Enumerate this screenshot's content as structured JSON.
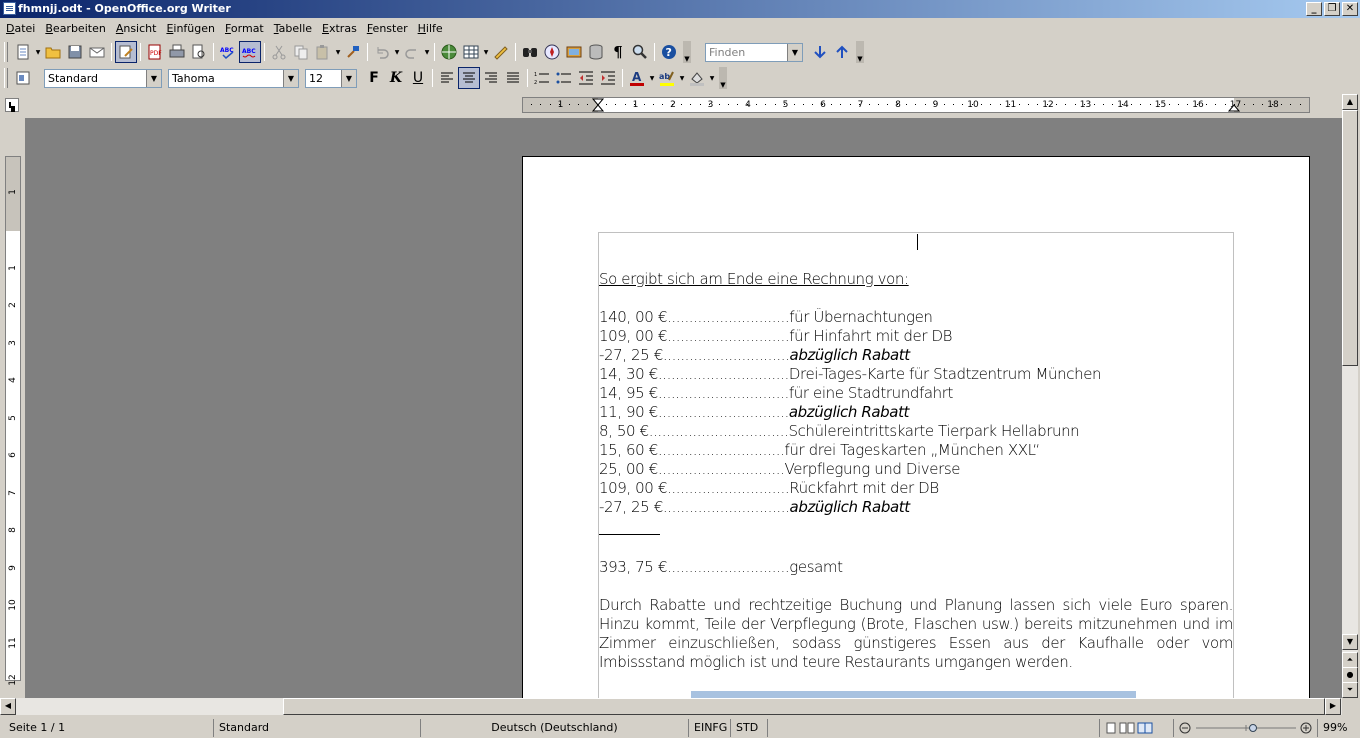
{
  "window": {
    "title": "fhmnjj.odt - OpenOffice.org Writer"
  },
  "menubar": [
    "Datei",
    "Bearbeiten",
    "Ansicht",
    "Einfügen",
    "Format",
    "Tabelle",
    "Extras",
    "Fenster",
    "Hilfe"
  ],
  "toolbar1": {
    "find_placeholder": "Finden"
  },
  "toolbar2": {
    "style": "Standard",
    "font": "Tahoma",
    "size": "12"
  },
  "ruler": {
    "labels": [
      "1",
      "1",
      "2",
      "3",
      "4",
      "5",
      "6",
      "7",
      "8",
      "9",
      "10",
      "11",
      "12",
      "13",
      "14",
      "15",
      "16",
      "17",
      "18"
    ]
  },
  "vruler": {
    "labels": [
      "1",
      "1",
      "2",
      "3",
      "4",
      "5",
      "6",
      "7",
      "8",
      "9",
      "10",
      "11",
      "12"
    ]
  },
  "document": {
    "heading": "So ergibt sich am Ende eine Rechnung von:",
    "items": [
      {
        "amount": "140, 00 €",
        "dots": "............................",
        "desc": "für Übernachtungen",
        "italic": false
      },
      {
        "amount": "109, 00 €",
        "dots": "............................",
        "desc": "für Hinfahrt mit der DB",
        "italic": false
      },
      {
        "amount": "-27, 25 €",
        "dots": ".............................",
        "desc": "abzüglich Rabatt",
        "italic": true
      },
      {
        "amount": "14, 30 €",
        "dots": "..............................",
        "desc": "Drei-Tages-Karte für Stadtzentrum München",
        "italic": false
      },
      {
        "amount": "14, 95 €",
        "dots": "..............................",
        "desc": "für eine Stadtrundfahrt",
        "italic": false
      },
      {
        "amount": "11, 90 €",
        "dots": "..............................",
        "desc": "abzüglich Rabatt",
        "italic": true
      },
      {
        "amount": "8, 50 €",
        "dots": "................................",
        "desc": "Schülereintrittskarte Tierpark Hellabrunn",
        "italic": false
      },
      {
        "amount": "15, 60 €",
        "dots": ".............................",
        "desc": "für drei Tageskarten „München XXL“",
        "italic": false
      },
      {
        "amount": "25, 00 €",
        "dots": ".............................",
        "desc": "Verpflegung und Diverse",
        "italic": false
      },
      {
        "amount": "109, 00 €",
        "dots": "............................",
        "desc": "Rückfahrt mit der DB",
        "italic": false
      },
      {
        "amount": "-27, 25 €",
        "dots": ".............................",
        "desc": "abzüglich Rabatt",
        "italic": true
      }
    ],
    "total": {
      "amount": "393, 75 €",
      "dots": "............................",
      "desc": "gesamt"
    },
    "paragraph": "Durch Rabatte und rechtzeitige Buchung und Planung lassen sich viele Euro sparen. Hinzu kommt, Teile der Verpflegung (Brote, Flaschen usw.) bereits mitzunehmen und im Zimmer einzuschließen, sodass günstigeres Essen aus der Kaufhalle oder vom Imbissstand möglich ist und teure Restaurants umgangen werden."
  },
  "statusbar": {
    "page": "Seite 1 / 1",
    "style": "Standard",
    "language": "Deutsch (Deutschland)",
    "insert_mode": "EINFG",
    "selection_mode": "STD",
    "zoom": "99%"
  },
  "colors": {
    "titlebar_start": "#0a246a",
    "titlebar_end": "#a6caf0",
    "workspace": "#808080",
    "font_color_bar": "#c00000",
    "highlight_bar": "#ffff00"
  }
}
